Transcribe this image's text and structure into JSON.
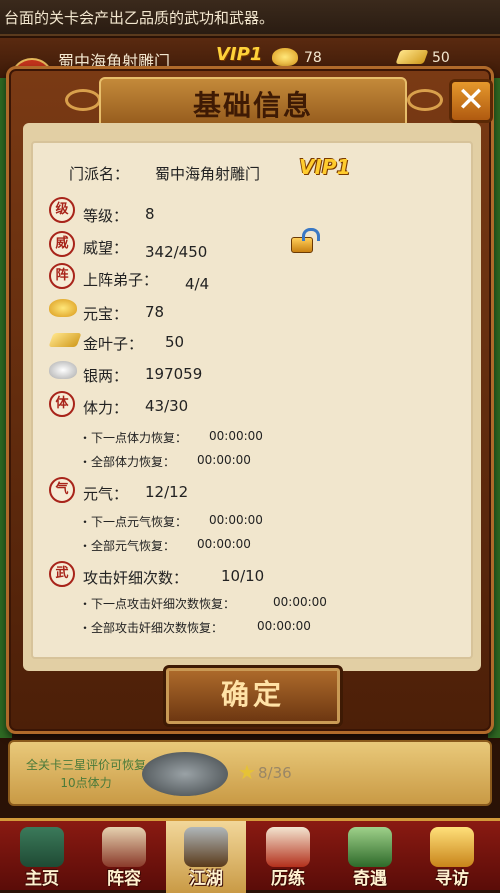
{
  "ticker": {
    "text": "台面的关卡会产出乙品质的武功和武器。"
  },
  "bg_header": {
    "name": "蜀中海角射雕门",
    "vip": "VIP1",
    "gold": "78",
    "leaf": "50"
  },
  "modal": {
    "title": "基础信息",
    "close_label": "✕",
    "confirm_label": "确定",
    "sect_label": "门派名：",
    "sect_value": "蜀中海角射雕门",
    "vip": "VIP1",
    "seals": {
      "level": "级",
      "prestige": "威",
      "lineup": "阵",
      "stamina": "体",
      "qi": "气",
      "attack": "武"
    },
    "rows": {
      "level_label": "等级：",
      "level_value": "8",
      "prestige_label": "威望：",
      "prestige_value": "342/450",
      "lineup_label": "上阵弟子：",
      "lineup_value": "4/4",
      "ingot_label": "元宝：",
      "ingot_value": "78",
      "leaf_label": "金叶子：",
      "leaf_value": "50",
      "silver_label": "银两：",
      "silver_value": "197059",
      "stamina_label": "体力：",
      "stamina_value": "43/30",
      "stamina_next_label": "・下一点体力恢复：",
      "stamina_next_value": "00:00:00",
      "stamina_all_label": "・全部体力恢复：",
      "stamina_all_value": "00:00:00",
      "qi_label": "元气：",
      "qi_value": "12/12",
      "qi_next_label": "・下一点元气恢复：",
      "qi_next_value": "00:00:00",
      "qi_all_label": "・全部元气恢复：",
      "qi_all_value": "00:00:00",
      "attack_label": "攻击奸细次数：",
      "attack_value": "10/10",
      "attack_next_label": "・下一点攻击奸细次数恢复：",
      "attack_next_value": "00:00:00",
      "attack_all_label": "・全部攻击奸细次数恢复：",
      "attack_all_value": "00:00:00"
    }
  },
  "bottom_panel": {
    "text": "全关卡三星评价可恢复10点体力",
    "count": "8/36"
  },
  "nav": [
    {
      "label": "主页",
      "icon": "pavilion-icon"
    },
    {
      "label": "阵容",
      "icon": "hero-icon"
    },
    {
      "label": "江湖",
      "icon": "sword-icon"
    },
    {
      "label": "历练",
      "icon": "scroll-icon"
    },
    {
      "label": "奇遇",
      "icon": "mountain-icon"
    },
    {
      "label": "寻访",
      "icon": "treasure-icon"
    }
  ],
  "colors": {
    "accent": "#a8241a",
    "gold": "#ffcc2e",
    "frame": "#7a3a14"
  }
}
